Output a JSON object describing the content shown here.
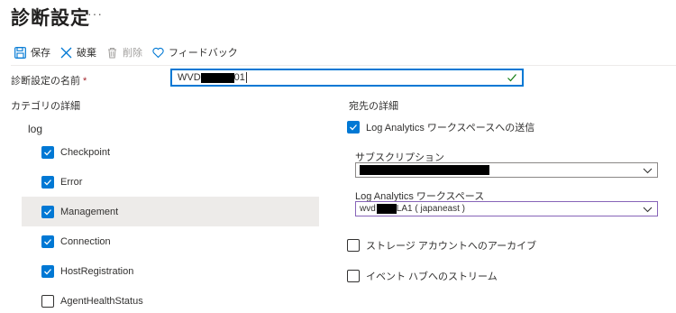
{
  "page": {
    "title": "診断設定",
    "more": "···"
  },
  "toolbar": {
    "save": "保存",
    "discard": "破棄",
    "delete": "削除",
    "feedback": "フィードバック"
  },
  "name_field": {
    "label": "診断設定の名前",
    "required_mark": "*",
    "value_prefix": "WVD",
    "value_suffix": "01"
  },
  "categories": {
    "section_label": "カテゴリの詳細",
    "group": "log",
    "items": [
      {
        "label": "Checkpoint",
        "checked": true
      },
      {
        "label": "Error",
        "checked": true
      },
      {
        "label": "Management",
        "checked": true
      },
      {
        "label": "Connection",
        "checked": true
      },
      {
        "label": "HostRegistration",
        "checked": true
      },
      {
        "label": "AgentHealthStatus",
        "checked": false
      }
    ]
  },
  "destination": {
    "section_label": "宛先の詳細",
    "log_analytics": {
      "label": "Log Analytics ワークスペースへの送信",
      "checked": true
    },
    "subscription_label": "サブスクリプション",
    "workspace_label": "Log Analytics ワークスペース",
    "workspace_prefix": "wvd",
    "workspace_suffix": "LA1 ( japaneast )",
    "storage": {
      "label": "ストレージ アカウントへのアーカイブ",
      "checked": false
    },
    "eventhub": {
      "label": "イベント ハブへのストリーム",
      "checked": false
    }
  },
  "colors": {
    "accent": "#0078d4",
    "text": "#323130",
    "selected_row": "#edebe9",
    "focus_purple": "#8764b8"
  }
}
